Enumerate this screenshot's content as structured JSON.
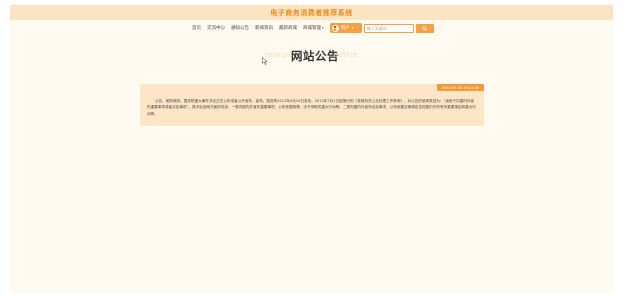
{
  "site": {
    "title": "电子商务消费者推荐系统"
  },
  "nav": {
    "items": [
      {
        "label": "首页",
        "has_dropdown": false
      },
      {
        "label": "交流中心",
        "has_dropdown": false
      },
      {
        "label": "通知公告",
        "has_dropdown": false
      },
      {
        "label": "新闻资讯",
        "has_dropdown": false
      },
      {
        "label": "最新商城",
        "has_dropdown": false
      },
      {
        "label": "商城管理",
        "has_dropdown": true
      }
    ],
    "user_label": "用户",
    "search_placeholder": "输入关键词"
  },
  "heading": {
    "main": "网站公告",
    "sub_left": "features",
    "sub_right": "notice"
  },
  "notice": {
    "date": "2023-03-31 19:21:48",
    "content": "公告，美丽政府。国务院重大事件决议正式公布或者公开宣布。宣布。国务院2012年4月10日发布，2012年7月1日起施行的《党政机关公文处理工作条例》，对公告的使用表述为：“适用于向国内外宣布重要事项或者法定事项”。具中包含两方面的内容：一是向国内外宣布重要事项，公布依据政策，法令采取的重大行动等。二是向国内外宣布法定事项，公布依据法律规定告知国内外的有关重要规定和重大行动等。"
  },
  "colors": {
    "accent": "#f5a142",
    "title_bar": "#fce3c1",
    "card": "#fde5c6",
    "page_bg": "#fffaf0"
  }
}
